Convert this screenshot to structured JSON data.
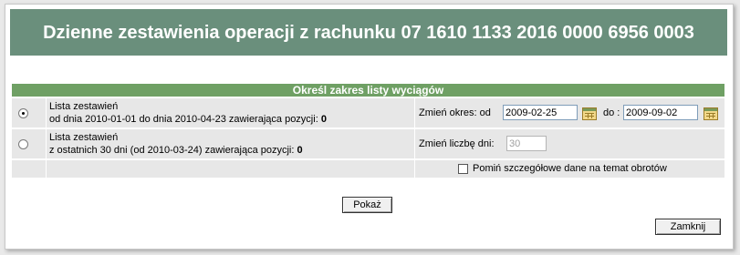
{
  "header": {
    "title": "Dzienne zestawienia operacji z rachunku 07 1610 1133 2016 0000 6956 0003"
  },
  "section": {
    "title": "Określ zakres listy wyciągów"
  },
  "option1": {
    "line1": "Lista zestawień",
    "line2_prefix": "od dnia 2010-01-01 do dnia 2010-04-23 zawierająca pozycji: ",
    "count": "0",
    "period_label": "Zmień okres: od",
    "from_value": "2009-02-25",
    "to_label": "do :",
    "to_value": "2009-09-02",
    "selected": true
  },
  "option2": {
    "line1": "Lista zestawień",
    "line2_prefix": "z ostatnich 30 dni (od 2010-03-24) zawierająca pozycji: ",
    "count": "0",
    "days_label": "Zmień liczbę dni:",
    "days_value": "30",
    "selected": false
  },
  "skip_details": {
    "label": "Pomiń szczegółowe dane na temat obrotów",
    "checked": false
  },
  "buttons": {
    "show": "Pokaż",
    "close": "Zamknij"
  },
  "colors": {
    "header_bg": "#6a8f7c",
    "section_bg": "#6fa064",
    "row_bg": "#e7e7e7"
  },
  "icons": {
    "calendar": "calendar-icon"
  }
}
